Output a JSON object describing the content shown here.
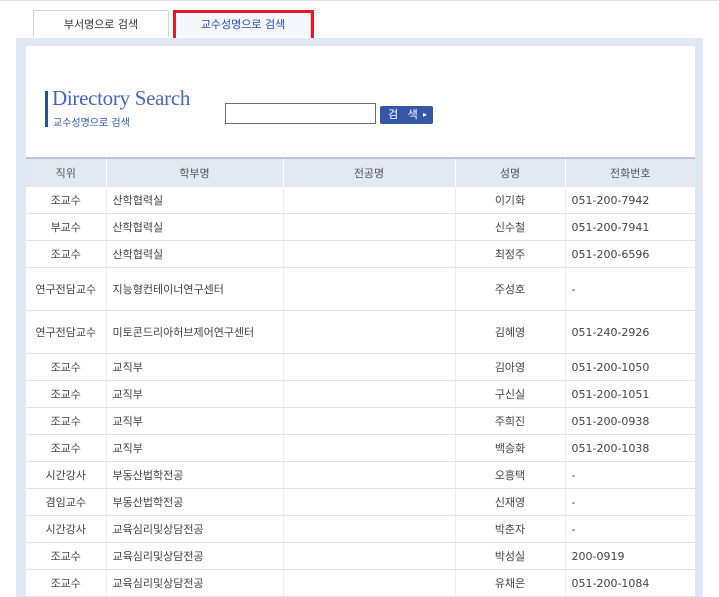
{
  "tabs": [
    {
      "label": "부서명으로 검색"
    },
    {
      "label": "교수성명으로 검색"
    }
  ],
  "logo": {
    "title": "Directory Search",
    "subtitle": "교수성명으로 검색"
  },
  "search": {
    "value": "",
    "button_label": "검 색",
    "button_arrow": "▸"
  },
  "table": {
    "headers": [
      "직위",
      "학부명",
      "전공명",
      "성명",
      "전화번호"
    ],
    "rows": [
      {
        "title": "조교수",
        "dept": "산학협력실",
        "major": "",
        "name": "이기화",
        "phone": "051-200-7942"
      },
      {
        "title": "부교수",
        "dept": "산학협력실",
        "major": "",
        "name": "신수철",
        "phone": "051-200-7941"
      },
      {
        "title": "조교수",
        "dept": "산학협력실",
        "major": "",
        "name": "최정주",
        "phone": "051-200-6596"
      },
      {
        "title": "연구전담교수",
        "dept": "지능형컨테이너연구센터",
        "major": "",
        "name": "주성호",
        "phone": "-"
      },
      {
        "title": "연구전담교수",
        "dept": "미토콘드리아허브제어연구센터",
        "major": "",
        "name": "김혜영",
        "phone": "051-240-2926"
      },
      {
        "title": "조교수",
        "dept": "교직부",
        "major": "",
        "name": "김아영",
        "phone": "051-200-1050"
      },
      {
        "title": "조교수",
        "dept": "교직부",
        "major": "",
        "name": "구신실",
        "phone": "051-200-1051"
      },
      {
        "title": "조교수",
        "dept": "교직부",
        "major": "",
        "name": "주희진",
        "phone": "051-200-0938"
      },
      {
        "title": "조교수",
        "dept": "교직부",
        "major": "",
        "name": "백승화",
        "phone": "051-200-1038"
      },
      {
        "title": "시간강사",
        "dept": "부동산법학전공",
        "major": "",
        "name": "오흥택",
        "phone": "-"
      },
      {
        "title": "겸임교수",
        "dept": "부동산법학전공",
        "major": "",
        "name": "신재영",
        "phone": "-"
      },
      {
        "title": "시간강사",
        "dept": "교육심리및상담전공",
        "major": "",
        "name": "박춘자",
        "phone": "-"
      },
      {
        "title": "조교수",
        "dept": "교육심리및상담전공",
        "major": "",
        "name": "박성실",
        "phone": "200-0919"
      },
      {
        "title": "조교수",
        "dept": "교육심리및상담전공",
        "major": "",
        "name": "유채은",
        "phone": "051-200-1084"
      }
    ]
  },
  "colors": {
    "accent": "#3557a8",
    "highlight_border": "#e41b23",
    "panel_bg": "#dfe8f3",
    "header_bg": "#e3e8f3"
  }
}
